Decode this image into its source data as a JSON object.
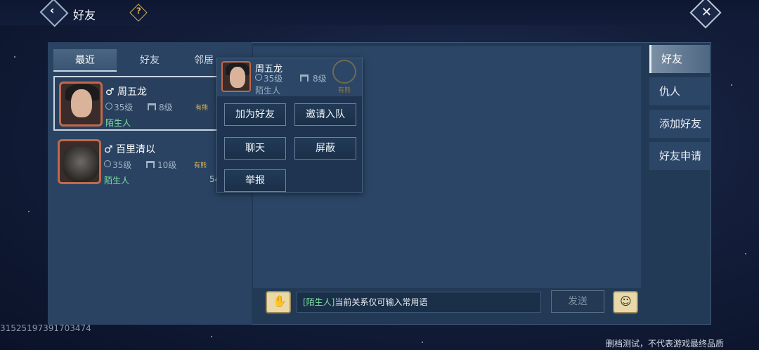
{
  "header": {
    "title": "好友",
    "back_icon": "chevron-left-icon",
    "help_icon": "question-icon",
    "close_icon": "close-icon"
  },
  "list_tabs": [
    "最近",
    "好友",
    "邻居"
  ],
  "friends": [
    {
      "name": "周五龙",
      "gender": "♂",
      "level": "35级",
      "guild": "8级",
      "tag": "有熊",
      "status": "陌生人",
      "extra": ""
    },
    {
      "name": "百里清以",
      "gender": "♂",
      "level": "35级",
      "guild": "10级",
      "tag": "有熊",
      "status": "陌生人",
      "extra": "54"
    }
  ],
  "popup": {
    "name": "周五龙",
    "level": "35级",
    "guild": "8级",
    "status": "陌生人",
    "emblem_tag": "有熊",
    "buttons": [
      "加为好友",
      "邀请入队",
      "聊天",
      "屏蔽",
      "举报"
    ]
  },
  "side_tabs": [
    "好友",
    "仇人",
    "添加好友",
    "好友申请"
  ],
  "chat": {
    "tag": "[陌生人]",
    "message": "当前关系仅可输入常用语",
    "send_label": "发送"
  },
  "footer": {
    "uid": "3152519739170347​4",
    "disclaimer": "删档测试，不代表游戏最终品质"
  },
  "colors": {
    "accent_green": "#7ee0a4",
    "gold": "#d8b25a",
    "panel": "#223a55"
  }
}
